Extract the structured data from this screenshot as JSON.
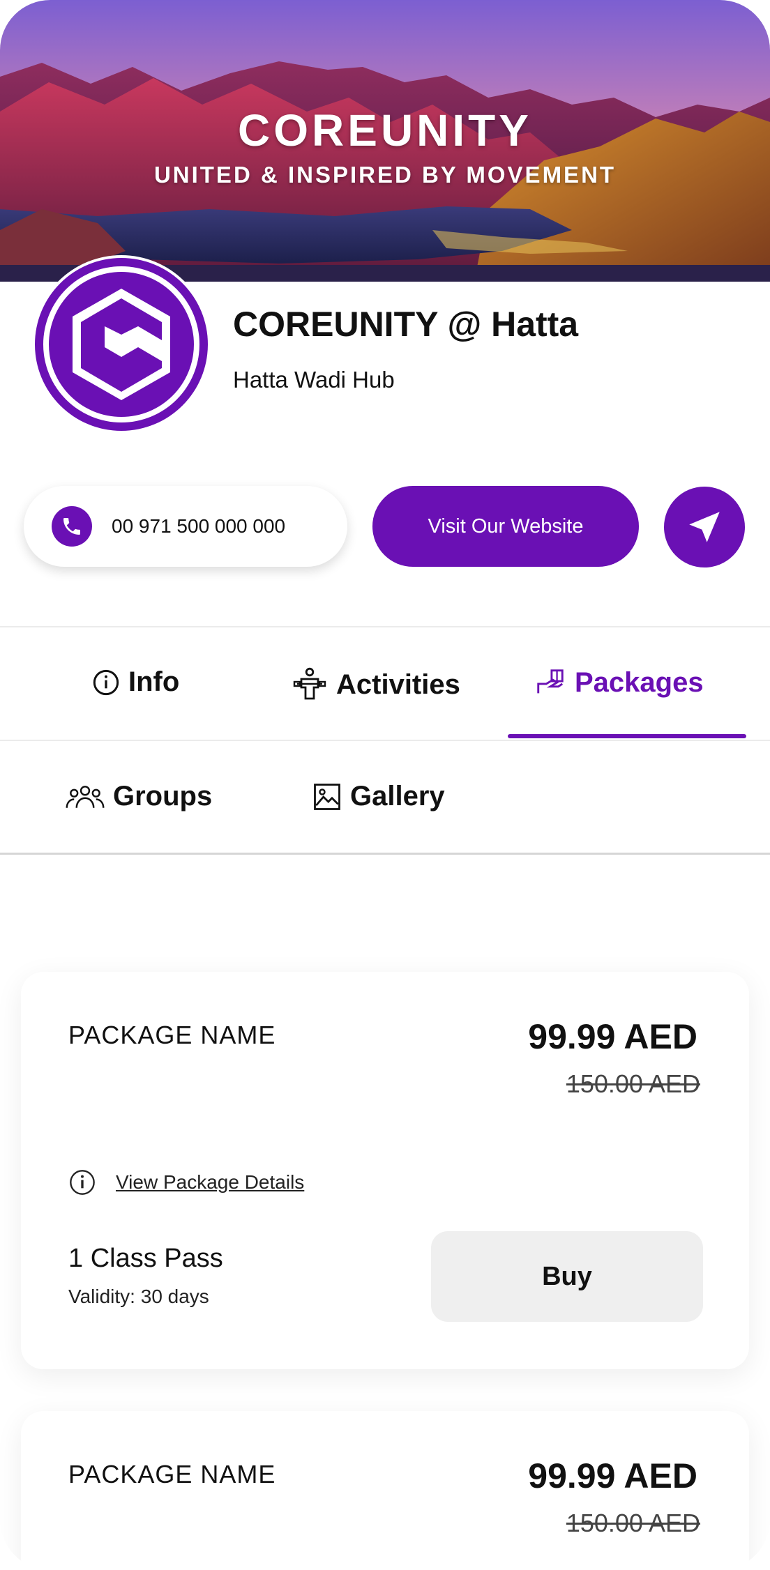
{
  "hero": {
    "title": "COREUNITY",
    "tagline": "UNITED & INSPIRED BY MOVEMENT"
  },
  "venue": {
    "name": "COREUNITY @ Hatta",
    "location": "Hatta Wadi Hub"
  },
  "contact": {
    "phone": "00 971 500 000 000",
    "website_label": "Visit Our Website"
  },
  "tabs": [
    {
      "label": "Info",
      "icon": "info-icon",
      "active": false
    },
    {
      "label": "Activities",
      "icon": "activities-icon",
      "active": false
    },
    {
      "label": "Packages",
      "icon": "packages-icon",
      "active": true
    },
    {
      "label": "Groups",
      "icon": "groups-icon",
      "active": false
    },
    {
      "label": "Gallery",
      "icon": "gallery-icon",
      "active": false
    }
  ],
  "packages": [
    {
      "name": "PACKAGE NAME",
      "price": "99.99 AED",
      "old_price": "150.00 AED",
      "details_link": "View Package Details",
      "pass": "1 Class Pass",
      "validity": "Validity: 30 days",
      "buy_label": "Buy"
    },
    {
      "name": "PACKAGE NAME",
      "price": "99.99 AED",
      "old_price": "150.00 AED"
    }
  ],
  "colors": {
    "brand": "#6a10b4",
    "button_grey": "#efefef"
  }
}
